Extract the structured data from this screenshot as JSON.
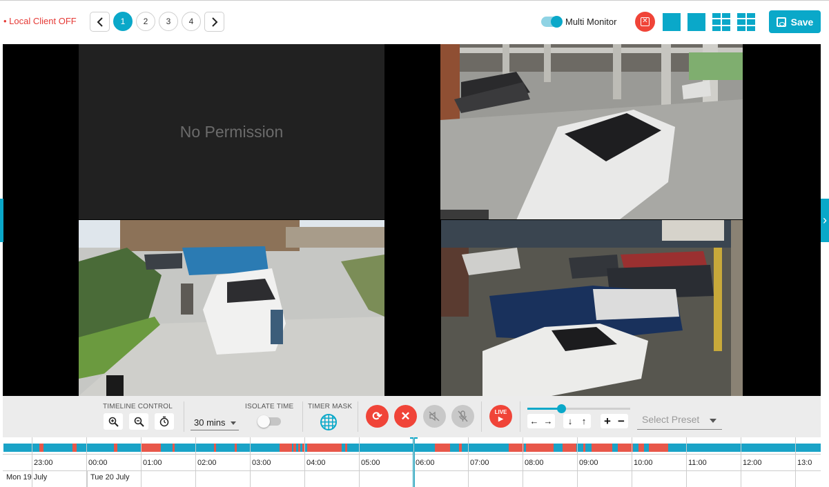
{
  "header": {
    "local_client_status": "• Local Client OFF",
    "pages": [
      "1",
      "2",
      "3",
      "4"
    ],
    "active_page": "1",
    "multi_monitor_label": "Multi Monitor",
    "save_label": "Save"
  },
  "cameras": {
    "no_permission_text": "No Permission"
  },
  "controls": {
    "timeline_control_label": "TIMELINE CONTROL",
    "duration_value": "30 mins",
    "isolate_time_label": "ISOLATE TIME",
    "timer_mask_label": "TIMER MASK",
    "live_label": "LIVE",
    "playback_speed": 0.33,
    "preset_placeholder": "Select Preset"
  },
  "timeline": {
    "hours": [
      "23:00",
      "00:00",
      "01:00",
      "02:00",
      "03:00",
      "04:00",
      "05:00",
      "06:00",
      "07:00",
      "08:00",
      "09:00",
      "10:00",
      "11:00",
      "12:00",
      "13:0"
    ],
    "dates": [
      "Mon 19 July",
      "Tue 20 July"
    ]
  },
  "colors": {
    "accent": "#0aa8c9",
    "danger": "#f04438",
    "event": "#e8574a"
  }
}
